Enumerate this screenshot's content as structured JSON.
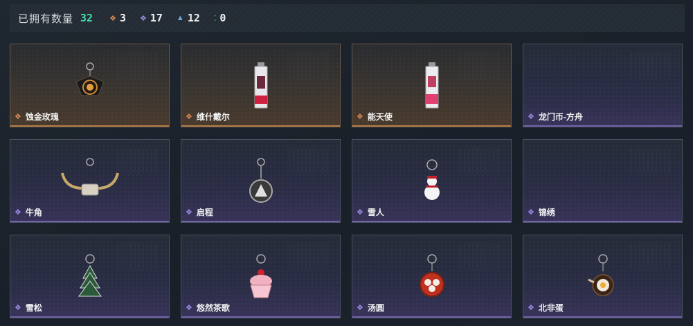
{
  "header": {
    "owned_label": "已拥有数量",
    "owned_count": "32",
    "stats": [
      {
        "icon": "orange-diamond-icon",
        "color": "#d58a55",
        "value": "3"
      },
      {
        "icon": "purple-diamond-icon",
        "color": "#9d8ae6",
        "value": "17"
      },
      {
        "icon": "blue-triangle-icon",
        "color": "#6aa8e0",
        "value": "12"
      },
      {
        "icon": "green-dots-icon",
        "color": "#3fe0a8",
        "value": "0"
      }
    ]
  },
  "items": [
    {
      "name": "蚀金玫瑰",
      "rarity": "orange"
    },
    {
      "name": "维什戴尔",
      "rarity": "orange"
    },
    {
      "name": "能天使",
      "rarity": "orange"
    },
    {
      "name": "龙门币-方舟",
      "rarity": "purple"
    },
    {
      "name": "牛角",
      "rarity": "purple"
    },
    {
      "name": "启程",
      "rarity": "purple"
    },
    {
      "name": "雪人",
      "rarity": "purple"
    },
    {
      "name": "锦绣",
      "rarity": "purple"
    },
    {
      "name": "雪松",
      "rarity": "purple"
    },
    {
      "name": "悠然茶歌",
      "rarity": "purple"
    },
    {
      "name": "汤圆",
      "rarity": "purple"
    },
    {
      "name": "北非蛋",
      "rarity": "purple"
    }
  ],
  "colors": {
    "owned_count": "#3fe0a8",
    "orange_rarity": "#d58a55",
    "purple_rarity": "#9d8ae6"
  }
}
